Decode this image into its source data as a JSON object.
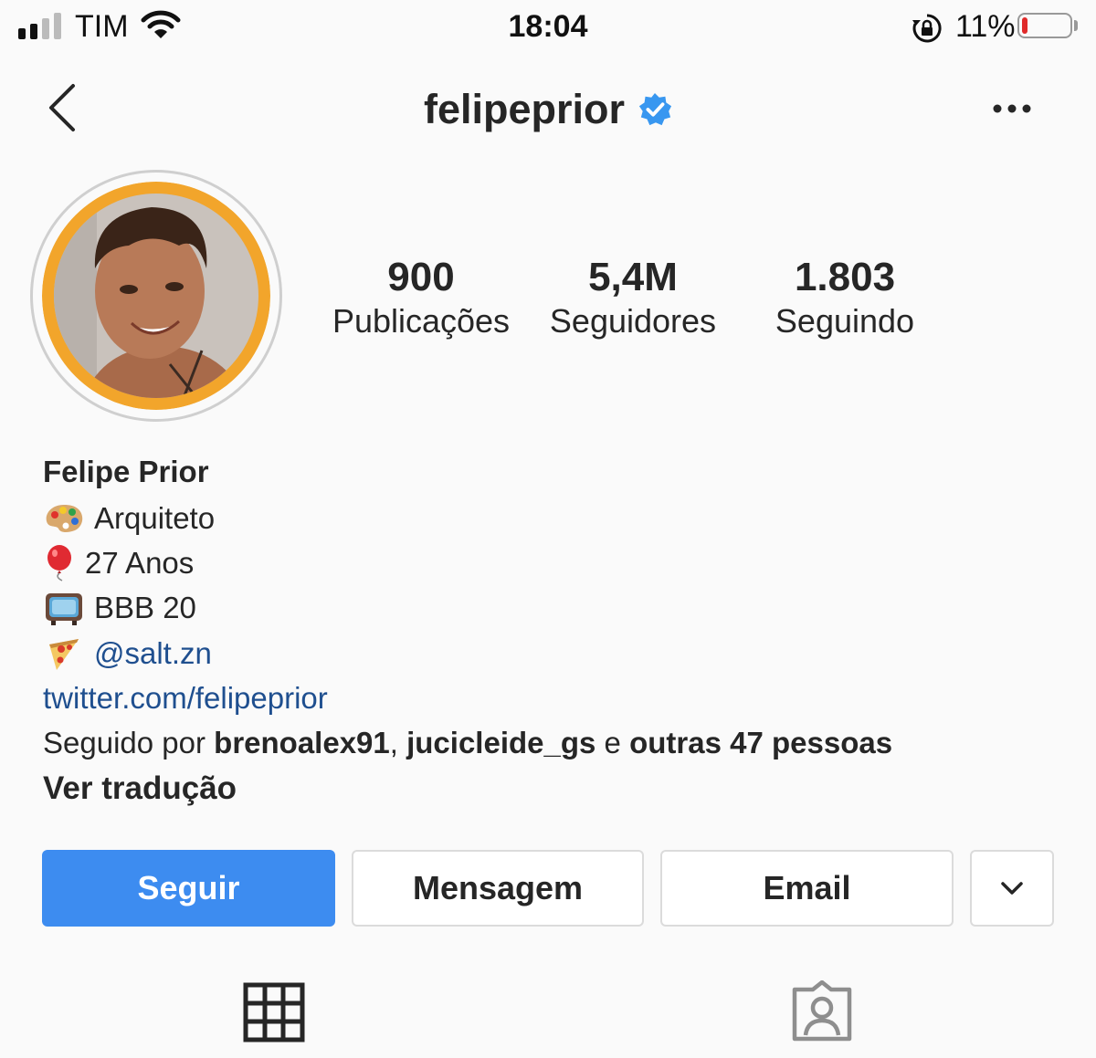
{
  "status_bar": {
    "carrier": "TIM",
    "time": "18:04",
    "battery": "11%",
    "battery_level": 0.11
  },
  "header": {
    "username": "felipeprior",
    "verified": true,
    "back_icon": "chevron-left-icon",
    "more_icon": "ellipsis-icon"
  },
  "stats": [
    {
      "value": "900",
      "label": "Publicações"
    },
    {
      "value": "5,4M",
      "label": "Seguidores"
    },
    {
      "value": "1.803",
      "label": "Seguindo"
    }
  ],
  "bio": {
    "name": "Felipe Prior",
    "lines": [
      {
        "icon": "palette-emoji",
        "text": "Arquiteto"
      },
      {
        "icon": "balloon-emoji",
        "text": "27 Anos"
      },
      {
        "icon": "television-emoji",
        "text": "BBB 20"
      },
      {
        "icon": "pizza-emoji",
        "text": "@salt.zn"
      }
    ],
    "website": "twitter.com/felipeprior",
    "followed_prefix": "Seguido por",
    "followed_user1": "brenoalex91",
    "followed_sep": ",",
    "followed_user2": "jucicleide_gs",
    "followed_and": "e",
    "followed_others": "outras 47 pessoas",
    "translate": "Ver tradução"
  },
  "buttons": {
    "follow": "Seguir",
    "message": "Mensagem",
    "email": "Email",
    "more_icon": "chevron-down-icon"
  },
  "tabs": [
    {
      "icon": "grid-icon"
    },
    {
      "icon": "tagged-person-icon"
    }
  ],
  "colors": {
    "accent": "#3d8cf0",
    "verified": "#3897f0",
    "link": "#1f4f8f",
    "story_ring": "#f2a52b"
  }
}
